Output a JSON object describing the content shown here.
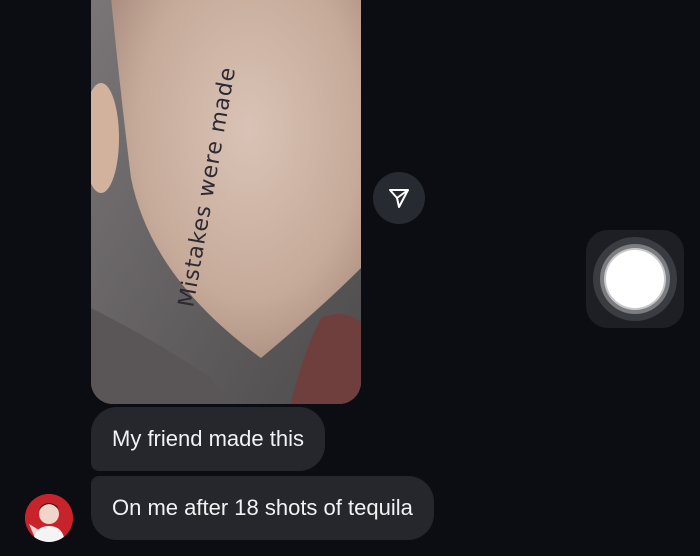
{
  "thread": {
    "photo": {
      "caption": "Mistakes were made",
      "description_icon": "tattoo-photo"
    },
    "share_icon": "send-paper-plane-icon",
    "messages": [
      {
        "text": "My friend made this"
      },
      {
        "text": "On me after 18 shots of tequila"
      }
    ],
    "sender_avatar_icon": "user-avatar"
  },
  "overlay": {
    "assistive_touch_icon": "assistive-touch-button"
  },
  "colors": {
    "background": "#0b0d12",
    "bubble": "#25272d",
    "text": "#f2f2f4",
    "share_button": "#272a31"
  }
}
